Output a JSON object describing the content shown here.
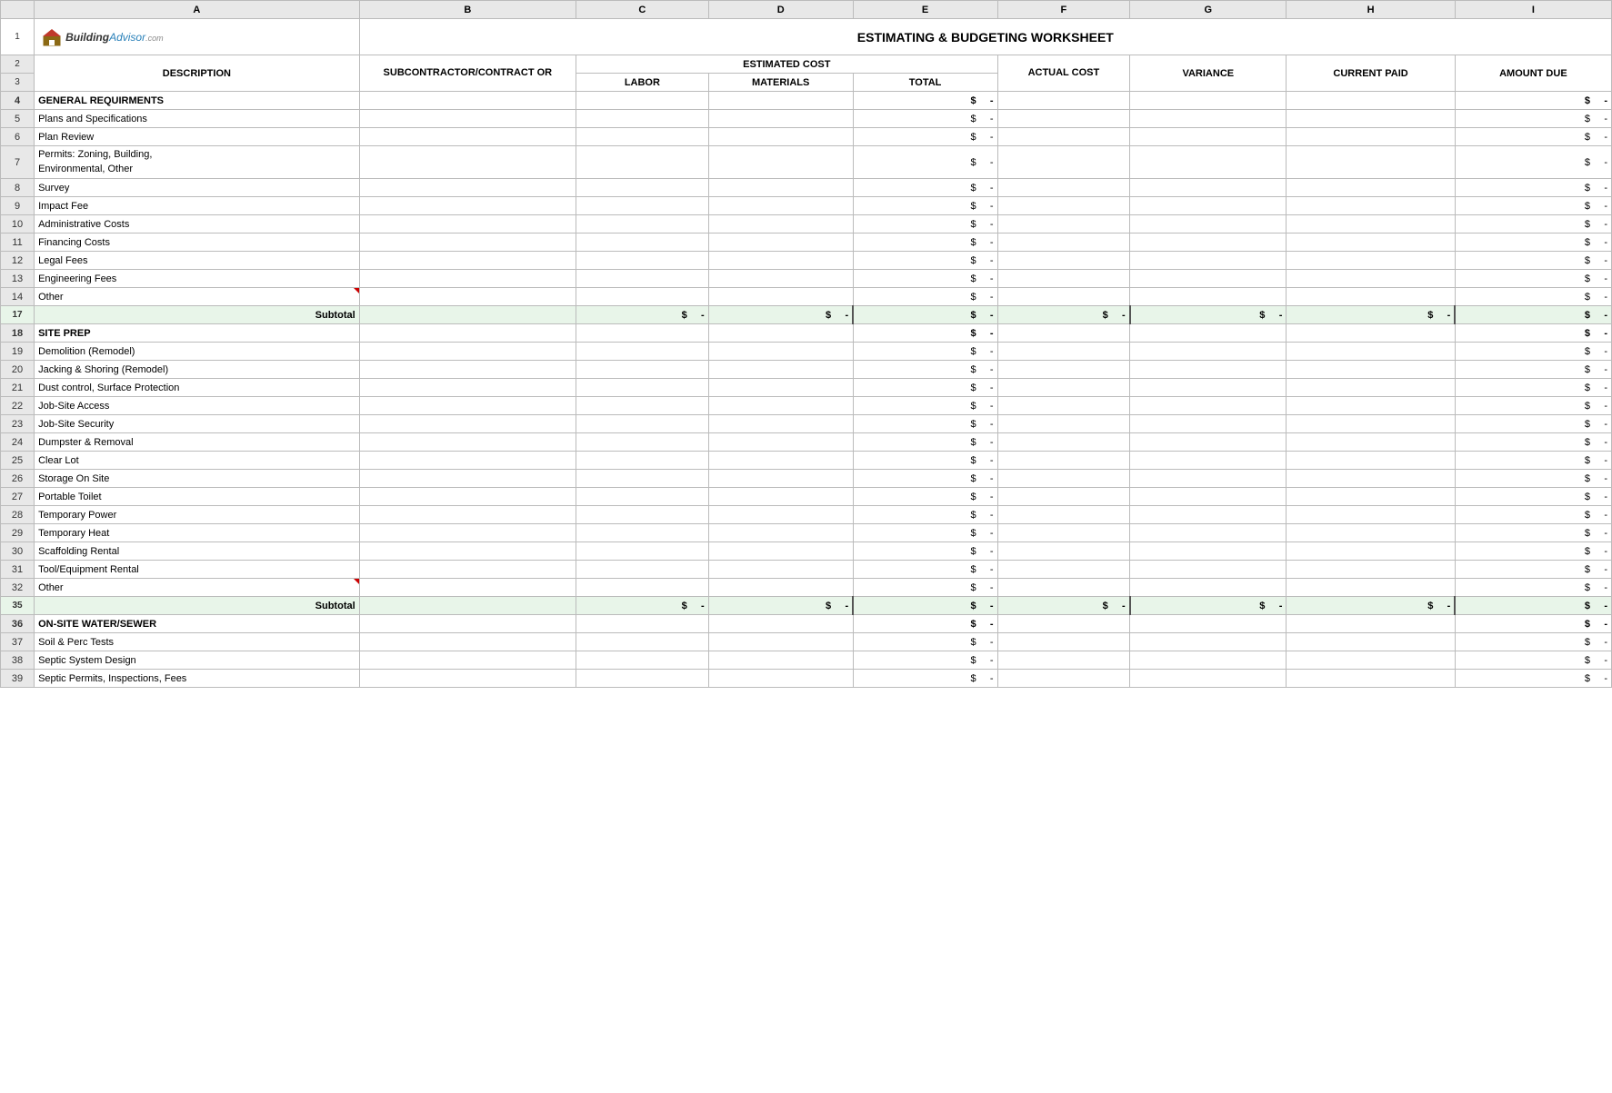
{
  "title": "ESTIMATING & BUDGETING WORKSHEET",
  "logo": {
    "text": "BuildingAdvisor",
    "com": ".com"
  },
  "columns": {
    "row_label": "",
    "a": "A",
    "b": "B",
    "c": "C",
    "d": "D",
    "e": "E",
    "f": "F",
    "g": "G",
    "h": "H",
    "i": "I"
  },
  "headers": {
    "description": "DESCRIPTION",
    "subcontractor": "SUBCONTRACTOR/CONTRACT OR",
    "estimated_cost": "ESTIMATED COST",
    "labor": "LABOR",
    "materials": "MATERIALS",
    "total": "TOTAL",
    "actual_cost": "ACTUAL COST",
    "variance": "VARIANCE",
    "current_paid": "CURRENT PAID",
    "amount_due": "AMOUNT DUE"
  },
  "sections": [
    {
      "id": "general",
      "row_start": 4,
      "section_label": "GENERAL REQUIRMENTS",
      "items": [
        {
          "row": 5,
          "label": "Plans and Specifications"
        },
        {
          "row": 6,
          "label": "Plan Review"
        },
        {
          "row": 7,
          "label": "Permits: Zoning, Building,\nEnvironmental, Other",
          "has_triangle": true
        },
        {
          "row": 8,
          "label": "Survey"
        },
        {
          "row": 9,
          "label": "Impact Fee"
        },
        {
          "row": 10,
          "label": "Administrative Costs"
        },
        {
          "row": 11,
          "label": "Financing Costs"
        },
        {
          "row": 12,
          "label": "Legal Fees"
        },
        {
          "row": 13,
          "label": "Engineering Fees"
        },
        {
          "row": 14,
          "label": "Other",
          "has_triangle": true
        }
      ],
      "subtotal_row": 17
    },
    {
      "id": "site_prep",
      "row_start": 18,
      "section_label": "SITE PREP",
      "items": [
        {
          "row": 19,
          "label": "Demolition (Remodel)"
        },
        {
          "row": 20,
          "label": "Jacking & Shoring (Remodel)"
        },
        {
          "row": 21,
          "label": "Dust control, Surface Protection"
        },
        {
          "row": 22,
          "label": "Job-Site Access"
        },
        {
          "row": 23,
          "label": "Job-Site Security"
        },
        {
          "row": 24,
          "label": "Dumpster & Removal"
        },
        {
          "row": 25,
          "label": "Clear Lot"
        },
        {
          "row": 26,
          "label": "Storage On Site"
        },
        {
          "row": 27,
          "label": "Portable Toilet"
        },
        {
          "row": 28,
          "label": "Temporary Power"
        },
        {
          "row": 29,
          "label": "Temporary Heat"
        },
        {
          "row": 30,
          "label": "Scaffolding Rental"
        },
        {
          "row": 31,
          "label": "Tool/Equipment Rental"
        },
        {
          "row": 32,
          "label": "Other",
          "has_triangle": true
        }
      ],
      "subtotal_row": 35
    },
    {
      "id": "onsite_water",
      "row_start": 36,
      "section_label": "ON-SITE WATER/SEWER",
      "items": [
        {
          "row": 37,
          "label": "Soil & Perc Tests"
        },
        {
          "row": 38,
          "label": "Septic System Design"
        },
        {
          "row": 39,
          "label": "Septic Permits, Inspections, Fees"
        }
      ]
    }
  ],
  "dollar_sign": "$",
  "dash": "-",
  "subtotal_label": "Subtotal",
  "colors": {
    "subtotal_bg": "#e8f5e9",
    "header_bg": "#ffffff",
    "col_header_bg": "#e8e8e8",
    "border": "#bbbbbb"
  }
}
